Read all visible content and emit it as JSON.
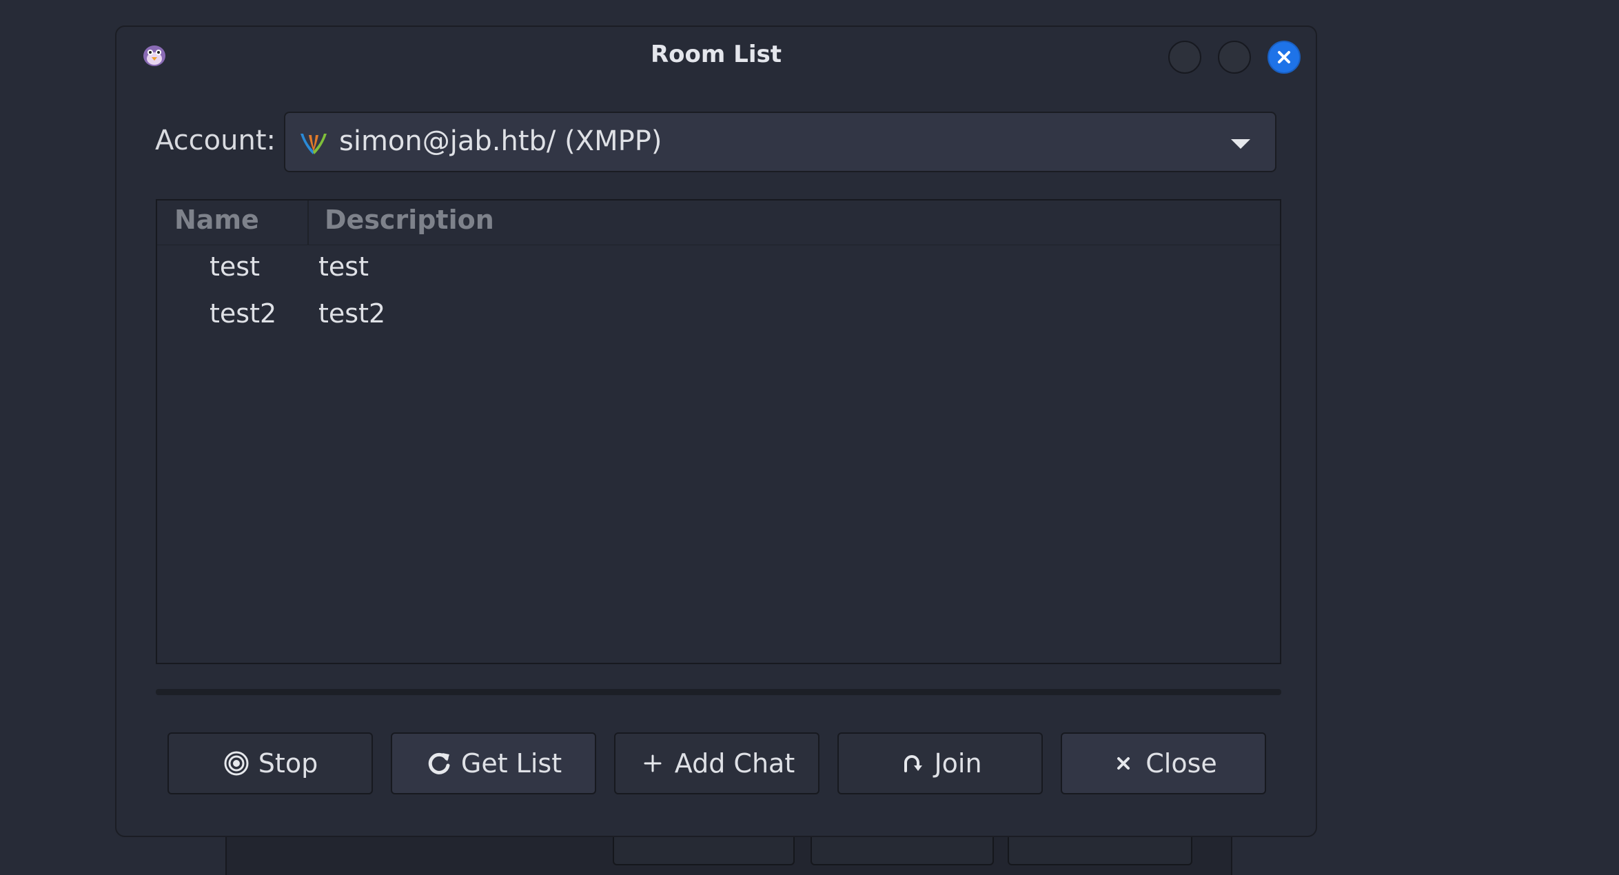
{
  "dialog": {
    "title": "Room List",
    "icon": "pidgin-icon"
  },
  "window_controls": {
    "minimize": "minimize-button",
    "maximize": "maximize-button",
    "close": "close-button"
  },
  "account": {
    "label": "Account:",
    "selected": "simon@jab.htb/ (XMPP)",
    "icon": "xmpp-icon"
  },
  "room_list": {
    "columns": [
      "Name",
      "Description"
    ],
    "rows": [
      {
        "name": "test",
        "description": "test"
      },
      {
        "name": "test2",
        "description": "test2"
      }
    ]
  },
  "buttons": {
    "stop": "Stop",
    "get_list": "Get List",
    "add_chat": "Add Chat",
    "join": "Join",
    "close": "Close"
  },
  "colors": {
    "accent": "#1e73e8",
    "background": "#272b37"
  }
}
